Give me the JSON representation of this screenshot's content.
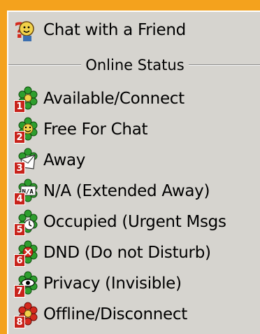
{
  "menu": {
    "chat": {
      "label": "Chat with a Friend",
      "icon": "chat-friend-icon"
    },
    "separator_label": "Online Status",
    "items": [
      {
        "badge": "1",
        "label": "Available/Connect",
        "icon": "flower-available-icon"
      },
      {
        "badge": "2",
        "label": "Free For Chat",
        "icon": "flower-free-for-chat-icon"
      },
      {
        "badge": "3",
        "label": "Away",
        "icon": "flower-away-icon"
      },
      {
        "badge": "4",
        "label": "N/A (Extended Away)",
        "icon": "flower-na-icon"
      },
      {
        "badge": "5",
        "label": "Occupied (Urgent Msgs",
        "icon": "flower-occupied-icon"
      },
      {
        "badge": "6",
        "label": "DND (Do not Disturb)",
        "icon": "flower-dnd-icon"
      },
      {
        "badge": "7",
        "label": "Privacy (Invisible)",
        "icon": "flower-privacy-icon"
      },
      {
        "badge": "8",
        "label": "Offline/Disconnect",
        "icon": "flower-offline-icon"
      }
    ]
  },
  "colors": {
    "frame": "#f4a21d",
    "menu_bg": "#d6d4cf",
    "badge": "#c8231b",
    "flower_green": "#2e9e2e",
    "flower_red": "#d42a1e"
  }
}
